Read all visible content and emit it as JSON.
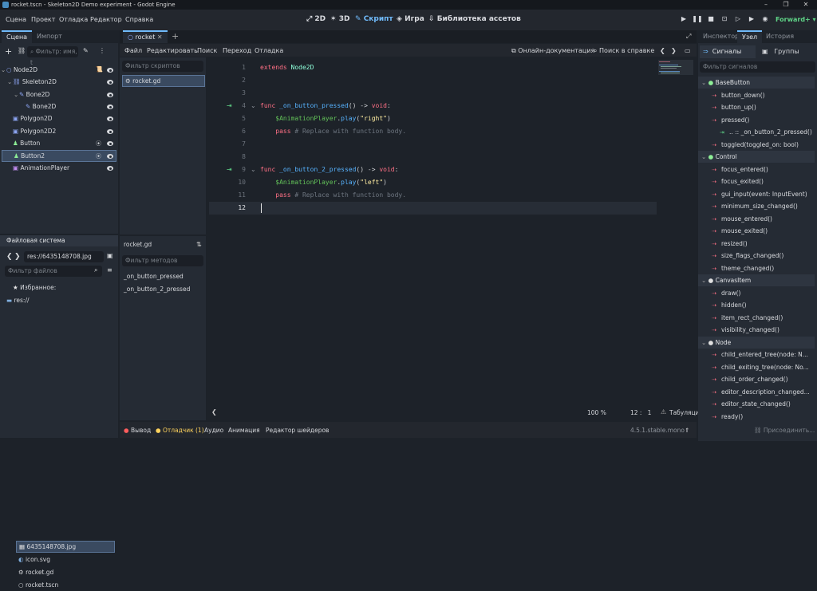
{
  "window": {
    "title": "rocket.tscn - Skeleton2D Demo experiment - Godot Engine"
  },
  "menu": [
    "Сцена",
    "Проект",
    "Отладка",
    "Редактор",
    "Справка"
  ],
  "workspaces": [
    "2D",
    "3D",
    "Скрипт",
    "Игра",
    "Библиотека ассетов"
  ],
  "renderer": "Forward+",
  "scene_dock": {
    "tabs": [
      "Сцена",
      "Импорт"
    ],
    "filter_placeholder": "Фильтр: имя, t",
    "nodes": [
      {
        "name": "Node2D",
        "icon_color": "#8da5f3"
      },
      {
        "name": "Skeleton2D",
        "icon_color": "#8da5f3"
      },
      {
        "name": "Bone2D",
        "icon_color": "#8da5f3"
      },
      {
        "name": "Bone2D",
        "icon_color": "#8da5f3"
      },
      {
        "name": "Polygon2D",
        "icon_color": "#8da5f3"
      },
      {
        "name": "Polygon2D2",
        "icon_color": "#8da5f3"
      },
      {
        "name": "Button",
        "icon_color": "#8eef97"
      },
      {
        "name": "Button2",
        "icon_color": "#8eef97"
      },
      {
        "name": "AnimationPlayer",
        "icon_color": "#c38ef1"
      }
    ]
  },
  "filesystem": {
    "title": "Файловая система",
    "path": "res://6435148708.jpg",
    "filter_placeholder": "Фильтр файлов",
    "favorites": "Избранное:",
    "root": "res://",
    "files": [
      "6435148708.jpg",
      "icon.svg",
      "rocket.gd",
      "rocket.tscn"
    ]
  },
  "script_editor": {
    "tab": "rocket",
    "menus": [
      "Файл",
      "Редактировать",
      "Поиск",
      "Переход",
      "Отладка"
    ],
    "online_docs": "Онлайн-документация",
    "help_search": "Поиск в справке",
    "scripts_filter": "Фильтр скриптов",
    "scripts": [
      "rocket.gd"
    ],
    "current_script": "rocket.gd",
    "methods_filter": "Фильтр методов",
    "methods": [
      "_on_button_pressed",
      "_on_button_2_pressed"
    ],
    "lines": [
      {
        "n": "1",
        "tokens": [
          [
            "kw",
            "extends "
          ],
          [
            "ty",
            "Node2D"
          ]
        ]
      },
      {
        "n": "2",
        "tokens": []
      },
      {
        "n": "3",
        "tokens": []
      },
      {
        "n": "4",
        "tokens": [
          [
            "kw",
            "func "
          ],
          [
            "fn",
            "_on_button_pressed"
          ],
          [
            "tx",
            "() -> "
          ],
          [
            "kw",
            "void"
          ],
          [
            "tx",
            ":"
          ]
        ]
      },
      {
        "n": "5",
        "tokens": [
          [
            "tx",
            "    "
          ],
          [
            "nd",
            "$AnimationPlayer"
          ],
          [
            "tx",
            "."
          ],
          [
            "fn",
            "play"
          ],
          [
            "tx",
            "("
          ],
          [
            "st",
            "\"right\""
          ],
          [
            "tx",
            ")"
          ]
        ]
      },
      {
        "n": "6",
        "tokens": [
          [
            "tx",
            "    "
          ],
          [
            "kw",
            "pass "
          ],
          [
            "cm",
            "# Replace with function body."
          ]
        ]
      },
      {
        "n": "7",
        "tokens": []
      },
      {
        "n": "8",
        "tokens": []
      },
      {
        "n": "9",
        "tokens": [
          [
            "kw",
            "func "
          ],
          [
            "fn",
            "_on_button_2_pressed"
          ],
          [
            "tx",
            "() -> "
          ],
          [
            "kw",
            "void"
          ],
          [
            "tx",
            ":"
          ]
        ]
      },
      {
        "n": "10",
        "tokens": [
          [
            "tx",
            "    "
          ],
          [
            "nd",
            "$AnimationPlayer"
          ],
          [
            "tx",
            "."
          ],
          [
            "fn",
            "play"
          ],
          [
            "tx",
            "("
          ],
          [
            "st",
            "\"left\""
          ],
          [
            "tx",
            ")"
          ]
        ]
      },
      {
        "n": "11",
        "tokens": [
          [
            "tx",
            "    "
          ],
          [
            "kw",
            "pass "
          ],
          [
            "cm",
            "# Replace with function body."
          ]
        ]
      },
      {
        "n": "12",
        "tokens": []
      }
    ],
    "zoom": "100 %",
    "cursor": "12 :   1",
    "indent": "Табуляция"
  },
  "bottom_panel": {
    "tabs": [
      "Вывод",
      "Отладчик (1)",
      "Аудио",
      "Анимация",
      "Редактор шейдеров"
    ],
    "version": "4.5.1.stable.mono"
  },
  "node_dock": {
    "tabs": [
      "Инспектор",
      "Узел",
      "История"
    ],
    "subtabs": [
      "Сигналы",
      "Группы"
    ],
    "filter_placeholder": "Фильтр сигналов",
    "connect_button": "Присоединить...",
    "items": [
      {
        "kind": "class",
        "text": "BaseButton"
      },
      {
        "kind": "signal",
        "text": "button_down()"
      },
      {
        "kind": "signal",
        "text": "button_up()"
      },
      {
        "kind": "signal",
        "text": "pressed()"
      },
      {
        "kind": "conn",
        "text": ".. :: _on_button_2_pressed()"
      },
      {
        "kind": "signal",
        "text": "toggled(toggled_on: bool)"
      },
      {
        "kind": "class",
        "text": "Control"
      },
      {
        "kind": "signal",
        "text": "focus_entered()"
      },
      {
        "kind": "signal",
        "text": "focus_exited()"
      },
      {
        "kind": "signal",
        "text": "gui_input(event: InputEvent)"
      },
      {
        "kind": "signal",
        "text": "minimum_size_changed()"
      },
      {
        "kind": "signal",
        "text": "mouse_entered()"
      },
      {
        "kind": "signal",
        "text": "mouse_exited()"
      },
      {
        "kind": "signal",
        "text": "resized()"
      },
      {
        "kind": "signal",
        "text": "size_flags_changed()"
      },
      {
        "kind": "signal",
        "text": "theme_changed()"
      },
      {
        "kind": "class",
        "text": "CanvasItem"
      },
      {
        "kind": "signal",
        "text": "draw()"
      },
      {
        "kind": "signal",
        "text": "hidden()"
      },
      {
        "kind": "signal",
        "text": "item_rect_changed()"
      },
      {
        "kind": "signal",
        "text": "visibility_changed()"
      },
      {
        "kind": "class",
        "text": "Node"
      },
      {
        "kind": "signal",
        "text": "child_entered_tree(node: N..."
      },
      {
        "kind": "signal",
        "text": "child_exiting_tree(node: No..."
      },
      {
        "kind": "signal",
        "text": "child_order_changed()"
      },
      {
        "kind": "signal",
        "text": "editor_description_changed..."
      },
      {
        "kind": "signal",
        "text": "editor_state_changed()"
      },
      {
        "kind": "signal",
        "text": "ready()"
      }
    ]
  }
}
